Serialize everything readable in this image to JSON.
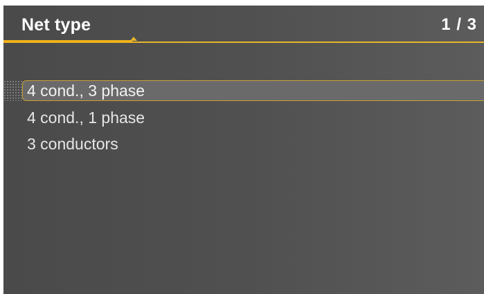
{
  "header": {
    "title": "Net type",
    "page_indicator": "1 / 3"
  },
  "list": {
    "items": [
      {
        "label": "4 cond., 3 phase",
        "selected": true
      },
      {
        "label": "4 cond., 1 phase",
        "selected": false
      },
      {
        "label": "3 conductors",
        "selected": false
      }
    ]
  },
  "colors": {
    "accent": "#f2b21b",
    "background": "#505050",
    "selection": "#6a6a6a",
    "text": "#e6e6e6"
  }
}
